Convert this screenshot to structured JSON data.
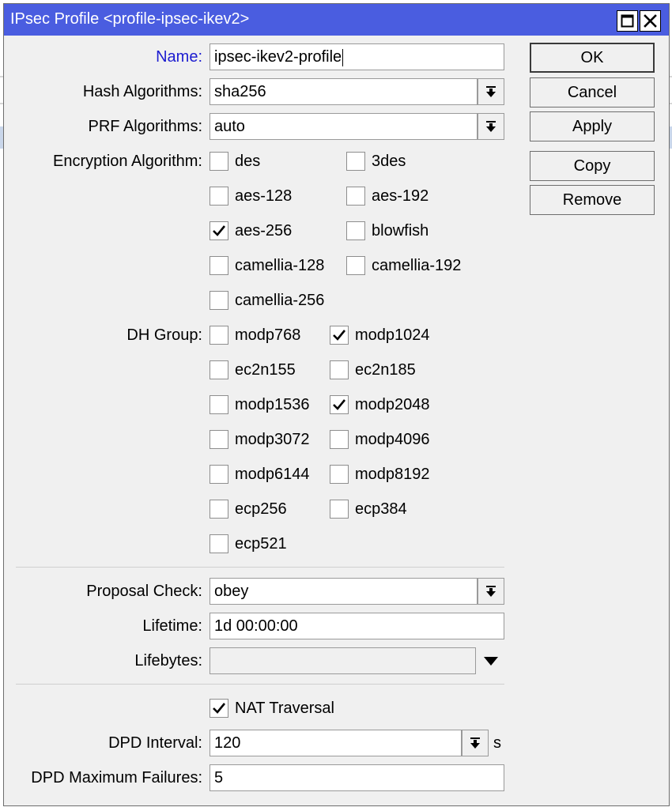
{
  "window": {
    "title": "IPsec Profile <profile-ipsec-ikev2>"
  },
  "fields": {
    "name": {
      "label": "Name:",
      "value": "ipsec-ikev2-profile"
    },
    "hash": {
      "label": "Hash Algorithms:",
      "value": "sha256"
    },
    "prf": {
      "label": "PRF Algorithms:",
      "value": "auto"
    },
    "proposal_check": {
      "label": "Proposal Check:",
      "value": "obey"
    },
    "lifetime": {
      "label": "Lifetime:",
      "value": "1d 00:00:00"
    },
    "lifebytes": {
      "label": "Lifebytes:",
      "value": ""
    },
    "dpd_interval": {
      "label": "DPD Interval:",
      "value": "120",
      "unit": "s"
    },
    "dpd_max_failures": {
      "label": "DPD Maximum Failures:",
      "value": "5"
    }
  },
  "encryption": {
    "label": "Encryption Algorithm:",
    "options": [
      {
        "label": "des",
        "checked": false
      },
      {
        "label": "3des",
        "checked": false
      },
      {
        "label": "aes-128",
        "checked": false
      },
      {
        "label": "aes-192",
        "checked": false
      },
      {
        "label": "aes-256",
        "checked": true
      },
      {
        "label": "blowfish",
        "checked": false
      },
      {
        "label": "camellia-128",
        "checked": false
      },
      {
        "label": "camellia-192",
        "checked": false
      },
      {
        "label": "camellia-256",
        "checked": false
      }
    ]
  },
  "dh_group": {
    "label": "DH Group:",
    "options": [
      {
        "label": "modp768",
        "checked": false
      },
      {
        "label": "modp1024",
        "checked": true
      },
      {
        "label": "ec2n155",
        "checked": false
      },
      {
        "label": "ec2n185",
        "checked": false
      },
      {
        "label": "modp1536",
        "checked": false
      },
      {
        "label": "modp2048",
        "checked": true
      },
      {
        "label": "modp3072",
        "checked": false
      },
      {
        "label": "modp4096",
        "checked": false
      },
      {
        "label": "modp6144",
        "checked": false
      },
      {
        "label": "modp8192",
        "checked": false
      },
      {
        "label": "ecp256",
        "checked": false
      },
      {
        "label": "ecp384",
        "checked": false
      },
      {
        "label": "ecp521",
        "checked": false
      }
    ]
  },
  "nat_traversal": {
    "label": "NAT Traversal",
    "checked": true
  },
  "buttons": {
    "ok": "OK",
    "cancel": "Cancel",
    "apply": "Apply",
    "copy": "Copy",
    "remove": "Remove"
  },
  "icons": {
    "maximize": "maximize-icon",
    "close": "close-icon",
    "dropdown": "dropdown-arrow-icon",
    "check": "checkmark-icon"
  },
  "colors": {
    "titlebar": "#4a5de0",
    "link_label": "#1c1cd0"
  }
}
